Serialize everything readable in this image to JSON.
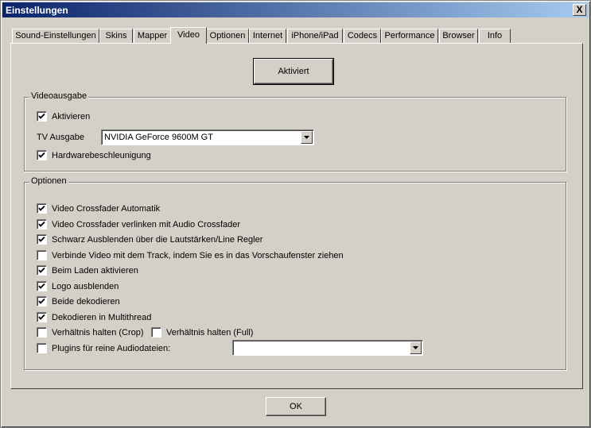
{
  "window": {
    "title": "Einstellungen",
    "close_label": "X"
  },
  "tabs": [
    {
      "label": "Sound-Einstellungen"
    },
    {
      "label": "Skins"
    },
    {
      "label": "Mapper"
    },
    {
      "label": "Video"
    },
    {
      "label": "Optionen"
    },
    {
      "label": "Internet"
    },
    {
      "label": "iPhone/iPad"
    },
    {
      "label": "Codecs"
    },
    {
      "label": "Performance"
    },
    {
      "label": "Browser"
    },
    {
      "label": "Info"
    }
  ],
  "active_tab": "Video",
  "activate_button": "Aktiviert",
  "videoausgabe": {
    "title": "Videoausgabe",
    "aktivieren": {
      "label": "Aktivieren",
      "checked": true
    },
    "tv_label": "TV Ausgabe",
    "tv_value": "NVIDIA GeForce 9600M GT",
    "hardware": {
      "label": "Hardwarebeschleunigung",
      "checked": true
    }
  },
  "optionen": {
    "title": "Optionen",
    "items": [
      {
        "label": "Video Crossfader Automatik",
        "checked": true
      },
      {
        "label": "Video Crossfader verlinken mit Audio Crossfader",
        "checked": true
      },
      {
        "label": "Schwarz Ausblenden über die Lautstärken/Line Regler",
        "checked": true
      },
      {
        "label": "Verbinde Video mit dem Track, indem Sie es in das Vorschaufenster ziehen",
        "checked": false
      },
      {
        "label": "Beim Laden aktivieren",
        "checked": true
      },
      {
        "label": "Logo ausblenden",
        "checked": true
      },
      {
        "label": "Beide dekodieren",
        "checked": true
      },
      {
        "label": "Dekodieren in Multithread",
        "checked": true
      }
    ],
    "crop": {
      "label": "Verhältnis halten (Crop)",
      "checked": false
    },
    "full": {
      "label": "Verhältnis halten (Full)",
      "checked": false
    },
    "plugins": {
      "label": "Plugins für reine Audiodateien:",
      "checked": false,
      "value": ""
    }
  },
  "ok_button": "OK"
}
